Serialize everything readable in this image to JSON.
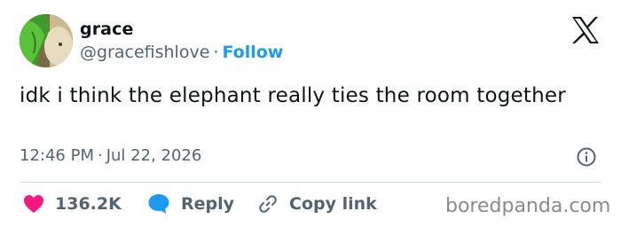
{
  "author": {
    "display_name": "grace",
    "handle": "@gracefishlove",
    "separator": "·",
    "follow_label": "Follow",
    "avatar_icon": "avatar-icon"
  },
  "brand": {
    "logo_icon": "x-logo-icon"
  },
  "tweet": {
    "text": "idk i think the elephant really ties the room together",
    "time": "12:46 PM",
    "separator": "·",
    "date": "Jul 22, 2026",
    "info_icon": "info-icon"
  },
  "actions": {
    "like": {
      "icon": "heart-icon",
      "count": "136.2K",
      "color": "#f91880"
    },
    "reply": {
      "icon": "speech-bubble-icon",
      "label": "Reply",
      "color": "#1d9bf0"
    },
    "copy_link": {
      "icon": "link-icon",
      "label": "Copy link"
    }
  },
  "watermark": "boredpanda.com",
  "colors": {
    "text_primary": "#0f1419",
    "text_secondary": "#536471",
    "accent": "#1d9bf0",
    "like": "#f91880",
    "divider": "#cfd9de"
  }
}
